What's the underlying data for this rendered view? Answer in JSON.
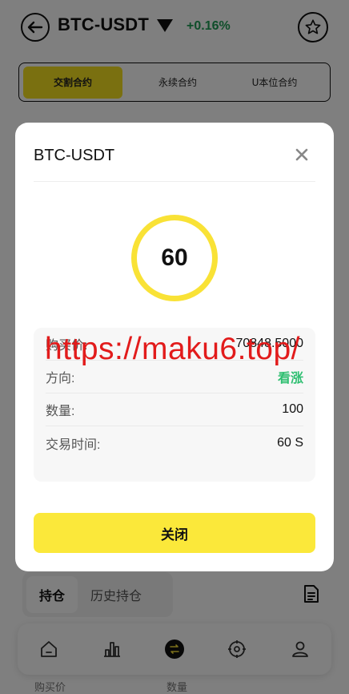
{
  "header": {
    "pair": "BTC-USDT",
    "change": "+0.16%",
    "icons": {
      "back": "back-arrow-icon",
      "dropdown": "caret-down-icon",
      "favorite": "star-icon"
    }
  },
  "contract_tabs": [
    {
      "label": "交割合约",
      "active": true
    },
    {
      "label": "永续合约",
      "active": false
    },
    {
      "label": "U本位合约",
      "active": false
    }
  ],
  "position_tabs": [
    {
      "label": "持仓",
      "active": true
    },
    {
      "label": "历史持仓",
      "active": false
    }
  ],
  "bottom_nav": [
    {
      "icon": "home-icon"
    },
    {
      "icon": "chart-bar-icon"
    },
    {
      "icon": "trade-swap-icon"
    },
    {
      "icon": "target-icon"
    },
    {
      "icon": "user-icon"
    }
  ],
  "table_headers": {
    "buy_price": "购买价",
    "quantity": "数量"
  },
  "modal": {
    "title": "BTC-USDT",
    "countdown": "60",
    "rows": [
      {
        "label": "购买价:",
        "value": "70848.5000"
      },
      {
        "label": "方向:",
        "value": "看涨"
      },
      {
        "label": "数量:",
        "value": "100"
      },
      {
        "label": "交易时间:",
        "value": "60 S"
      }
    ],
    "close_label": "关闭"
  },
  "watermark": "https://maku6.top/",
  "colors": {
    "accent": "#f9e236",
    "up": "#2fbf71",
    "change": "#1f9d55",
    "watermark": "#e21b1b"
  }
}
